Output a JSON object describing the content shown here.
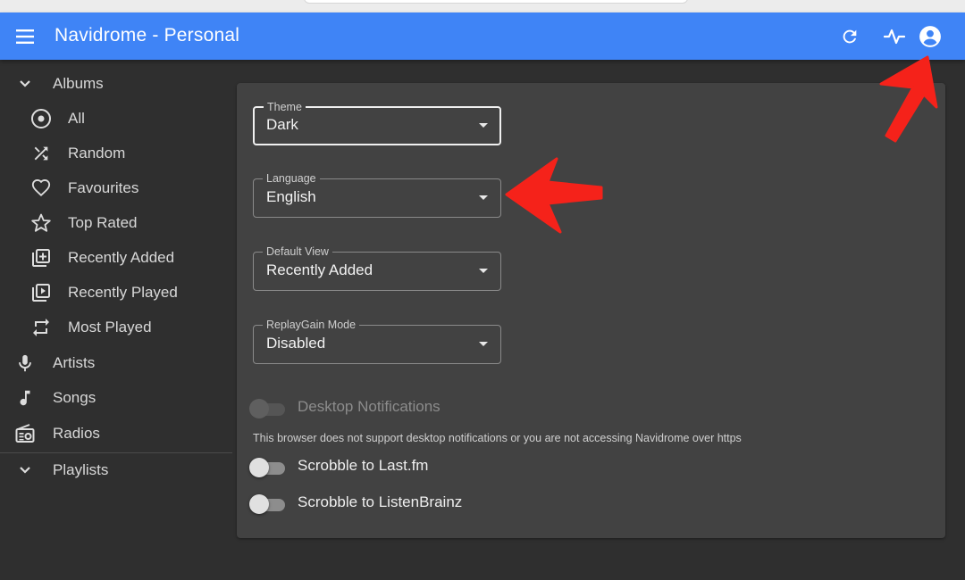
{
  "app": {
    "title": "Navidrome - Personal"
  },
  "toolbar": {
    "menu_icon": "hamburger-menu-icon",
    "refresh_icon": "refresh-icon",
    "activity_icon": "activity-pulse-icon",
    "account_icon": "account-circle-icon",
    "accent_color": "#3f84f6"
  },
  "sidebar": {
    "albums": {
      "label": "Albums",
      "icon": "chevron-down-icon",
      "items": [
        {
          "label": "All",
          "icon": "album-disc-icon"
        },
        {
          "label": "Random",
          "icon": "shuffle-icon"
        },
        {
          "label": "Favourites",
          "icon": "heart-outline-icon"
        },
        {
          "label": "Top Rated",
          "icon": "star-outline-icon"
        },
        {
          "label": "Recently Added",
          "icon": "library-add-icon"
        },
        {
          "label": "Recently Played",
          "icon": "library-play-icon"
        },
        {
          "label": "Most Played",
          "icon": "repeat-icon"
        }
      ]
    },
    "artists": {
      "label": "Artists",
      "icon": "microphone-icon"
    },
    "songs": {
      "label": "Songs",
      "icon": "music-note-icon"
    },
    "radios": {
      "label": "Radios",
      "icon": "radio-icon"
    },
    "playlists": {
      "label": "Playlists",
      "icon": "chevron-down-icon"
    }
  },
  "settings": {
    "theme": {
      "label": "Theme",
      "value": "Dark"
    },
    "language": {
      "label": "Language",
      "value": "English"
    },
    "default_view": {
      "label": "Default View",
      "value": "Recently Added"
    },
    "replaygain": {
      "label": "ReplayGain Mode",
      "value": "Disabled"
    },
    "desktop_notifications": {
      "label": "Desktop Notifications",
      "enabled": false,
      "disabled": true,
      "helper": "This browser does not support desktop notifications or you are not accessing Navidrome over https"
    },
    "scrobble_lastfm": {
      "label": "Scrobble to Last.fm",
      "enabled": false
    },
    "scrobble_listenbrainz": {
      "label": "Scrobble to ListenBrainz",
      "enabled": false
    }
  },
  "annotations": {
    "arrow_color": "#f5221a"
  }
}
